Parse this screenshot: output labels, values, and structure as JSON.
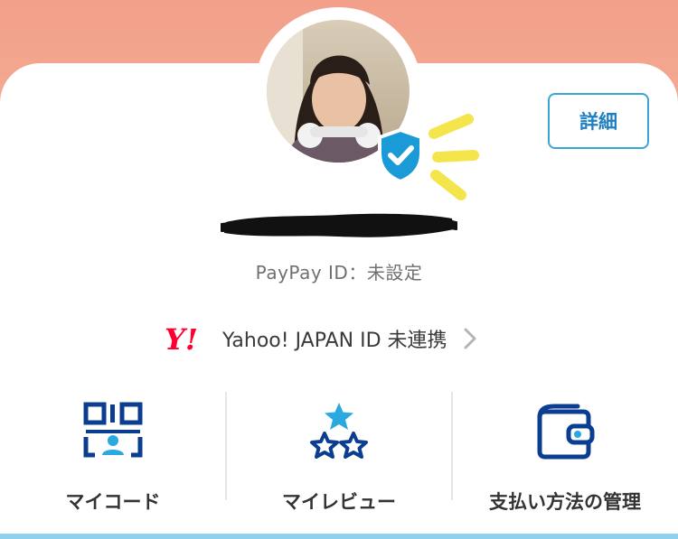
{
  "profile": {
    "detail_button": "詳細",
    "paypay_id_line": "PayPay ID：未設定",
    "yahoo_logo": "Y!",
    "yahoo_link": "Yahoo! JAPAN ID 未連携"
  },
  "actions": [
    {
      "label": "マイコード",
      "icon": "qr-code-user-icon"
    },
    {
      "label": "マイレビュー",
      "icon": "stars-icon"
    },
    {
      "label": "支払い方法の管理",
      "icon": "wallet-icon"
    }
  ],
  "colors": {
    "header_gradient_top": "#f2a08a",
    "accent_blue": "#1f7fc0",
    "icon_navy": "#0b3d91",
    "icon_cyan": "#2aa9e0",
    "yahoo_red": "#ff0033",
    "verified_blue": "#1a9ad6"
  }
}
